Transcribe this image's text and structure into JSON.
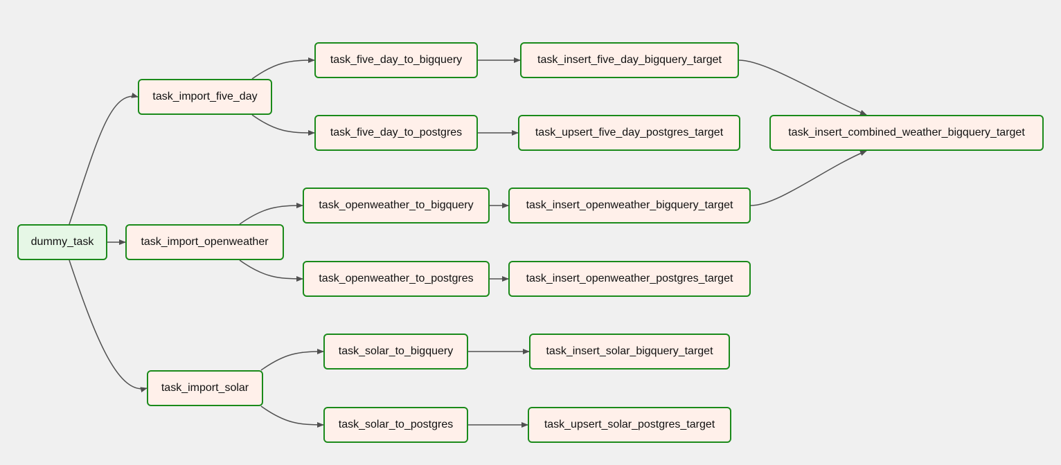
{
  "colors": {
    "node_border": "#1a8a1a",
    "node_fill": "#fff0ea",
    "root_fill": "#e6f7e6",
    "edge": "#505050",
    "background": "#f0f0f0"
  },
  "nodes": {
    "dummy_task": "dummy_task",
    "task_import_five_day": "task_import_five_day",
    "task_import_openweather": "task_import_openweather",
    "task_import_solar": "task_import_solar",
    "task_five_day_to_bigquery": "task_five_day_to_bigquery",
    "task_five_day_to_postgres": "task_five_day_to_postgres",
    "task_openweather_to_bigquery": "task_openweather_to_bigquery",
    "task_openweather_to_postgres": "task_openweather_to_postgres",
    "task_solar_to_bigquery": "task_solar_to_bigquery",
    "task_solar_to_postgres": "task_solar_to_postgres",
    "task_insert_five_day_bigquery_target": "task_insert_five_day_bigquery_target",
    "task_upsert_five_day_postgres_target": "task_upsert_five_day_postgres_target",
    "task_insert_openweather_bigquery_target": "task_insert_openweather_bigquery_target",
    "task_insert_openweather_postgres_target": "task_insert_openweather_postgres_target",
    "task_insert_solar_bigquery_target": "task_insert_solar_bigquery_target",
    "task_upsert_solar_postgres_target": "task_upsert_solar_postgres_target",
    "task_insert_combined_weather_bigquery_target": "task_insert_combined_weather_bigquery_target"
  },
  "edges": [
    [
      "dummy_task",
      "task_import_five_day"
    ],
    [
      "dummy_task",
      "task_import_openweather"
    ],
    [
      "dummy_task",
      "task_import_solar"
    ],
    [
      "task_import_five_day",
      "task_five_day_to_bigquery"
    ],
    [
      "task_import_five_day",
      "task_five_day_to_postgres"
    ],
    [
      "task_import_openweather",
      "task_openweather_to_bigquery"
    ],
    [
      "task_import_openweather",
      "task_openweather_to_postgres"
    ],
    [
      "task_import_solar",
      "task_solar_to_bigquery"
    ],
    [
      "task_import_solar",
      "task_solar_to_postgres"
    ],
    [
      "task_five_day_to_bigquery",
      "task_insert_five_day_bigquery_target"
    ],
    [
      "task_five_day_to_postgres",
      "task_upsert_five_day_postgres_target"
    ],
    [
      "task_openweather_to_bigquery",
      "task_insert_openweather_bigquery_target"
    ],
    [
      "task_openweather_to_postgres",
      "task_insert_openweather_postgres_target"
    ],
    [
      "task_solar_to_bigquery",
      "task_insert_solar_bigquery_target"
    ],
    [
      "task_solar_to_postgres",
      "task_upsert_solar_postgres_target"
    ],
    [
      "task_insert_five_day_bigquery_target",
      "task_insert_combined_weather_bigquery_target"
    ],
    [
      "task_insert_openweather_bigquery_target",
      "task_insert_combined_weather_bigquery_target"
    ]
  ]
}
